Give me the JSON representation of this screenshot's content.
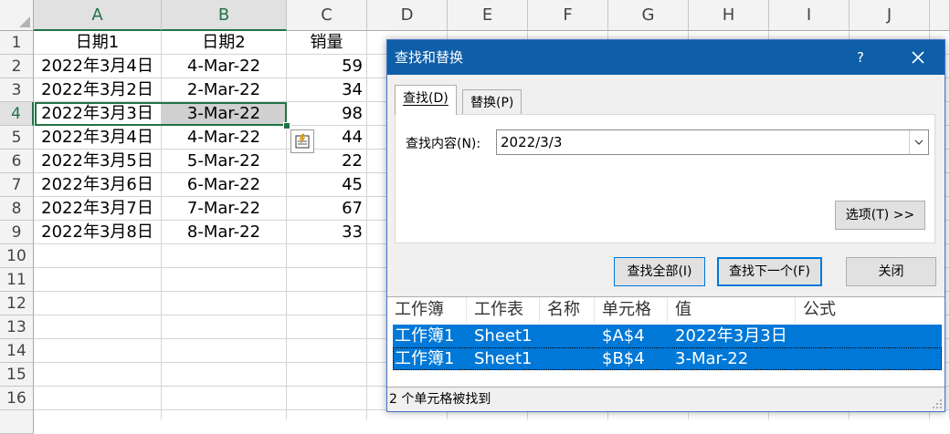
{
  "spreadsheet": {
    "columns": [
      "A",
      "B",
      "C",
      "D",
      "E",
      "F",
      "G",
      "H",
      "I",
      "J"
    ],
    "rows": [
      "1",
      "2",
      "3",
      "4",
      "5",
      "6",
      "7",
      "8",
      "9",
      "10",
      "11",
      "12",
      "13",
      "14",
      "15",
      "16"
    ],
    "header_row": {
      "a": "日期1",
      "b": "日期2",
      "c": "销量"
    },
    "data": [
      {
        "a": "2022年3月4日",
        "b": "4-Mar-22",
        "c": "59"
      },
      {
        "a": "2022年3月2日",
        "b": "2-Mar-22",
        "c": "34"
      },
      {
        "a": "2022年3月3日",
        "b": "3-Mar-22",
        "c": "98"
      },
      {
        "a": "2022年3月4日",
        "b": "4-Mar-22",
        "c": "44"
      },
      {
        "a": "2022年3月5日",
        "b": "5-Mar-22",
        "c": "22"
      },
      {
        "a": "2022年3月6日",
        "b": "6-Mar-22",
        "c": "45"
      },
      {
        "a": "2022年3月7日",
        "b": "7-Mar-22",
        "c": "67"
      },
      {
        "a": "2022年3月8日",
        "b": "8-Mar-22",
        "c": "33"
      }
    ],
    "quick_analysis_icon": "quick-analysis-icon"
  },
  "dialog": {
    "title": "查找和替换",
    "help": "?",
    "close": "✕",
    "tab_find": "查找(D)",
    "tab_replace": "替换(P)",
    "find_label": "查找内容(N):",
    "find_value": "2022/3/3",
    "options_button": "选项(T) >>",
    "find_all_button": "查找全部(I)",
    "find_next_button": "查找下一个(F)",
    "close_button": "关闭",
    "result_headers": [
      "工作簿",
      "工作表",
      "名称",
      "单元格",
      "值",
      "公式"
    ],
    "results": [
      {
        "workbook": "工作簿1",
        "sheet": "Sheet1",
        "name": "",
        "cell": "$A$4",
        "value": "2022年3月3日",
        "formula": ""
      },
      {
        "workbook": "工作簿1",
        "sheet": "Sheet1",
        "name": "",
        "cell": "$B$4",
        "value": "3-Mar-22",
        "formula": ""
      }
    ],
    "status": "2 个单元格被找到"
  },
  "colors": {
    "accent": "#217346",
    "title_bar": "#0f5fa8",
    "selection": "#0078d7"
  }
}
